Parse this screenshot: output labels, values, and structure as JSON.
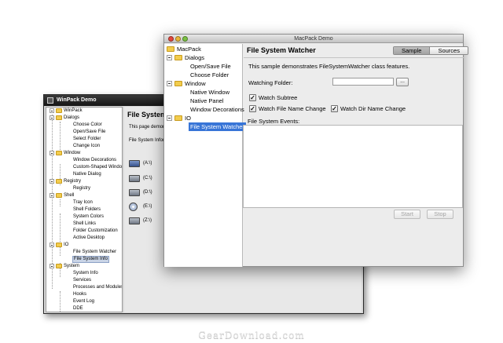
{
  "winpack": {
    "title": "WinPack Demo",
    "tree": {
      "root": "WinPack",
      "groups": [
        {
          "label": "Dialogs",
          "items": [
            "Choose Color",
            "Open/Save File",
            "Select Folder",
            "Change Icon"
          ]
        },
        {
          "label": "Window",
          "items": [
            "Window Decorations",
            "Custom-Shaped Window",
            "Native Dialog"
          ]
        },
        {
          "label": "Registry",
          "items": [
            "Registry"
          ]
        },
        {
          "label": "Shell",
          "items": [
            "Tray Icon",
            "Shell Folders",
            "System Colors",
            "Shell Links",
            "Folder Customization",
            "Active Desktop"
          ]
        },
        {
          "label": "IO",
          "items": [
            "File System Watcher",
            "File System Info"
          ]
        },
        {
          "label": "System",
          "items": [
            "System Info",
            "Services",
            "Processes and Modules",
            "Hooks",
            "Event Log",
            "DDE"
          ]
        }
      ],
      "selected": "File System Info"
    },
    "main": {
      "heading": "File System I",
      "description": "This page demon",
      "info_label": "File System Inform",
      "drives": [
        "(A:\\)",
        "(C:\\)",
        "(D:\\)",
        "(E:\\)",
        "(Z:\\)"
      ]
    }
  },
  "macpack": {
    "title": "MacPack Demo",
    "tree": {
      "root": "MacPack",
      "groups": [
        {
          "label": "Dialogs",
          "items": [
            "Open/Save File",
            "Choose Folder"
          ]
        },
        {
          "label": "Window",
          "items": [
            "Native Window",
            "Native Panel",
            "Window Decorations"
          ]
        },
        {
          "label": "IO",
          "items": [
            "File System Watcher"
          ]
        }
      ],
      "selected": "File System Watcher"
    },
    "main": {
      "heading": "File System Watcher",
      "tabs": [
        {
          "label": "Sample",
          "active": true
        },
        {
          "label": "Sources",
          "active": false
        }
      ],
      "description": "This sample demonstrates FileSystemWatcher class features.",
      "watching_folder_label": "Watching Folder:",
      "watching_folder_value": "",
      "browse_label": "...",
      "checkboxes": [
        {
          "label": "Watch Subtree",
          "checked": true
        },
        {
          "label": "Watch File Name Change",
          "checked": true
        },
        {
          "label": "Watch Dir Name Change",
          "checked": true
        }
      ],
      "events_label": "File System Events:",
      "start_label": "Start",
      "stop_label": "Stop"
    }
  },
  "watermark": "GearDownload.com",
  "colors": {
    "selection_blue": "#3875d7",
    "folder_yellow": "#f2cc4d",
    "close_red": "#e2463c",
    "minimize_yellow": "#e9b63a",
    "zoom_green": "#7ac142"
  }
}
